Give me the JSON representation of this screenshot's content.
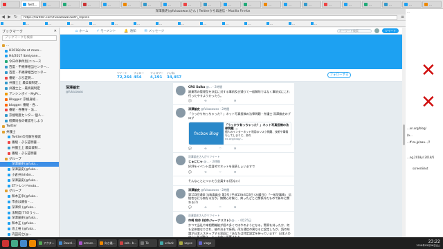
{
  "os_tabs": [
    "",
    "Twitt...",
    "…",
    "…",
    "…",
    "…",
    "…",
    "…",
    "…",
    "…",
    "…",
    "…",
    "…",
    "…",
    "…",
    "…",
    "…",
    "…",
    "…",
    "…",
    "…",
    "…"
  ],
  "window_title": "深澤諭史(@fukazawas)さん | Twitterから再送信 - Mozilla Firefox",
  "nav": {
    "back": "◀",
    "forward": "▶",
    "reload": "↻",
    "url": "https://twitter.com/fukazawas/with_replies",
    "menu": "≡"
  },
  "bookmarks": [
    "",
    "…",
    "…",
    "…",
    "…",
    "…",
    "…",
    "…",
    "…",
    "…",
    "…",
    "…",
    "…",
    "…",
    "…"
  ],
  "sidebar": {
    "title": "ブックマーク",
    "close": "✕",
    "search_placeholder": "ブックマークを検索",
    "items": [
      {
        "label": "…",
        "indent": 0,
        "color": "#e0a030",
        "selected": false
      },
      {
        "label": "H2018/site at marx...",
        "indent": 4,
        "color": "#1da1f2",
        "selected": false
      },
      {
        "label": "H4/2017 lbmiyane...",
        "indent": 4,
        "color": "#1da1f2",
        "selected": false
      },
      {
        "label": "今日の事件別(ニュース",
        "indent": 4,
        "color": "#2a7",
        "selected": false
      },
      {
        "label": "百度 - 不規律相当センター...",
        "indent": 4,
        "color": "#39c",
        "selected": false
      },
      {
        "label": "百度 - 不規律相当センター",
        "indent": 4,
        "color": "#39c",
        "selected": false
      },
      {
        "label": "番組 - ぷら証明...",
        "indent": 4,
        "color": "#e44",
        "selected": false
      },
      {
        "label": "弁護士上 最高裁制定...",
        "indent": 4,
        "color": "#39c",
        "selected": false
      },
      {
        "label": "弁護士上 - 最高裁制定",
        "indent": 4,
        "color": "#39c",
        "selected": false
      },
      {
        "label": "アンシンポイ - MyPr...",
        "indent": 4,
        "color": "#e90",
        "selected": false
      },
      {
        "label": "Blogger: 京極身総...",
        "indent": 4,
        "color": "#f60",
        "selected": false
      },
      {
        "label": "blogger: 番組 - 各...",
        "indent": 4,
        "color": "#f60",
        "selected": false
      },
      {
        "label": "番組 - 各種令 - 法...",
        "indent": 4,
        "color": "#e44",
        "selected": false
      },
      {
        "label": "京極制度センター 個人...",
        "indent": 4,
        "color": "#39c",
        "selected": false
      },
      {
        "label": "経費局会の確認をしよう",
        "indent": 4,
        "color": "#39c",
        "selected": false
      },
      {
        "label": "Twitter",
        "indent": 0,
        "color": "#e0a030",
        "selected": false
      },
      {
        "label": "弁護士",
        "indent": 0,
        "color": "#e0a030",
        "selected": false
      },
      {
        "label": "Twitterの見解を検索",
        "indent": 8,
        "color": "#1da1f2",
        "selected": false
      },
      {
        "label": "番組 - ぷら証明書...",
        "indent": 8,
        "color": "#e44",
        "selected": false
      },
      {
        "label": "弁護士上 最高裁制...",
        "indent": 8,
        "color": "#39c",
        "selected": false
      },
      {
        "label": "番組 - ぷら証明書",
        "indent": 8,
        "color": "#e44",
        "selected": false
      },
      {
        "label": "グループ",
        "indent": 4,
        "color": "#e0a030",
        "selected": false
      },
      {
        "label": "深澤諭史(@fuka...",
        "indent": 8,
        "color": "#1da1f2",
        "selected": true
      },
      {
        "label": "深澤諭史(@fuka...",
        "indent": 8,
        "color": "#1da1f2",
        "selected": false
      },
      {
        "label": "小倉弁(kh4m...",
        "indent": 8,
        "color": "#1da1f2",
        "selected": false
      },
      {
        "label": "深澤諭史(@fuka...",
        "indent": 8,
        "color": "#1da1f2",
        "selected": false
      },
      {
        "label": "ETトレンドmoto...",
        "indent": 8,
        "color": "#1da1f2",
        "selected": false
      },
      {
        "label": "グループ",
        "indent": 4,
        "color": "#e0a030",
        "selected": false
      },
      {
        "label": "和木正幸(@fuka...",
        "indent": 8,
        "color": "#1da1f2",
        "selected": false
      },
      {
        "label": "市会は議会 - ...",
        "indent": 8,
        "color": "#1da1f2",
        "selected": false
      },
      {
        "label": "深澤伝 (@fuka...",
        "indent": 8,
        "color": "#1da1f2",
        "selected": false
      },
      {
        "label": "法制度(77のうっ...",
        "indent": 8,
        "color": "#1da1f2",
        "selected": false
      },
      {
        "label": "深澤諭史(@fuka...",
        "indent": 8,
        "color": "#1da1f2",
        "selected": false
      },
      {
        "label": "和木正 (@fuka...",
        "indent": 8,
        "color": "#1da1f2",
        "selected": false
      },
      {
        "label": "池上裕 (@fuka...",
        "indent": 8,
        "color": "#1da1f2",
        "selected": false
      },
      {
        "label": "内田前之(@...",
        "indent": 8,
        "color": "#1da1f2",
        "selected": false
      },
      {
        "label": "内田(の先) KK...",
        "indent": 8,
        "color": "#1da1f2",
        "selected": false
      }
    ]
  },
  "twitter": {
    "nav": [
      {
        "icon": "⌂",
        "label": "ホーム"
      },
      {
        "icon": "⚡",
        "label": "モーメント"
      },
      {
        "icon": "🔔",
        "label": "通知"
      },
      {
        "icon": "✉",
        "label": "メッセージ"
      }
    ],
    "search_placeholder": "キーワード検索",
    "tweet_button": "ツイート",
    "profile": {
      "name": "深澤諭史",
      "handle": "@fukazawas",
      "stats": [
        {
          "label": "ツイート",
          "value": "72,264"
        },
        {
          "label": "フォロー",
          "value": "454"
        },
        {
          "label": "フォロワー",
          "value": "4,191"
        },
        {
          "label": "いいね",
          "value": "34,457"
        }
      ],
      "follow_button": "フォローする"
    },
    "tweets": [
      {
        "context": "",
        "name": "CRG Suika",
        "handle": "@…",
        "time": "2時間",
        "text": "副業等の管理型を決定に対する事前及び通りて一般解除ではなく事前式にこれ行ったやすようかったら。",
        "card": null
      },
      {
        "context": "",
        "name": "深澤諭史",
        "handle": "@fukazawas",
        "time": "2時間",
        "text": "「うっかり有っちゃった？」ネット写真投稿の法律問題 - 弁護士 深澤諭史のブログ",
        "card": {
          "brand": "fncbox Blog",
          "title": "「うっかり有っちゃった？」ネット写真投稿の法律問題 ...",
          "desc": "個人のインターネット利用のリスク問題、技術や事情もしてしまうと、あれ",
          "domain": "ex.org/blog/..."
        }
      },
      {
        "context": "深澤諭史さんがリツイート",
        "name": "じゅにじゃ",
        "handle": "@…",
        "time": "2時間",
        "text": "好評をイベント話目的でネットを発表しょいますで",
        "card": null
      },
      {
        "context": "",
        "name": "",
        "handle": "",
        "time": "",
        "text": "そんなことについたら全員する(否ない)",
        "card": null
      },
      {
        "context": "",
        "name": "深澤諭史",
        "handle": "@fukazawas",
        "time": "2時間",
        "text": "第153回通常 法務委員会 第3号 (平成13年4月3日 (水曜日)) 「一般型事情」 伝統性なにも無なる方が。無関心対象に、典ったどこに関係外だもので新年に関わる(?)",
        "card": null
      },
      {
        "context": "深澤諭史さんがリツイート",
        "name": "市崎 和作 (柏市ジャーナリスト)",
        "handle": "@…",
        "time": "4月25日",
        "text": "かつて当社や来相関機能が個々多くでは今のようになる。警察を持ったか、何も全体使なりされ、被の決まで接続。両方通信の異なるに設定したが、読の知識が日本人ステップする家庭に「あなたは特定設定を持っています？ 日本人の中心に処が数え、と一方的に設置された。",
        "card": null
      }
    ]
  },
  "right_panel": {
    "texts": [
      "...",
      "...xn.org/blog/",
      "(a...",
      "...ff.zo.jp/aaa.../?",
      "...ng.2018y/ 2018/5",
      "screenShot"
    ]
  },
  "taskbar": {
    "tasks": [
      "アクター",
      "Downl...",
      "emacs...",
      "向き最...",
      "xob - b...",
      "Tk",
      "xclock",
      "xeyes",
      "xlogo"
    ],
    "time": "23:22",
    "date": "2018年05月26日(土)"
  }
}
